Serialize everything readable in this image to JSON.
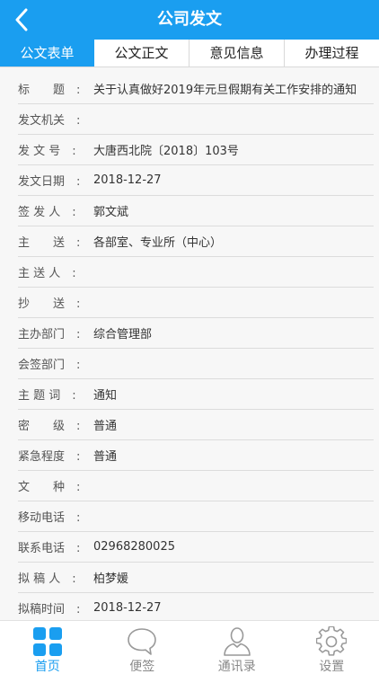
{
  "header": {
    "title": "公司发文"
  },
  "tabs": [
    {
      "label": "公文表单"
    },
    {
      "label": "公文正文"
    },
    {
      "label": "意见信息"
    },
    {
      "label": "办理过程"
    }
  ],
  "form": {
    "rows": [
      {
        "label": "标　　题　:",
        "value": "关于认真做好2019年元旦假期有关工作安排的通知"
      },
      {
        "label": "发文机关　:",
        "value": ""
      },
      {
        "label": "发 文 号　:",
        "value": "大唐西北院〔2018〕103号"
      },
      {
        "label": "发文日期　:",
        "value": "2018-12-27"
      },
      {
        "label": "签 发 人　:",
        "value": "郭文斌"
      },
      {
        "label": "主　　送　:",
        "value": "各部室、专业所（中心）"
      },
      {
        "label": "主 送 人　:",
        "value": ""
      },
      {
        "label": "抄　　送　:",
        "value": ""
      },
      {
        "label": "主办部门　:",
        "value": "综合管理部"
      },
      {
        "label": "会签部门　:",
        "value": ""
      },
      {
        "label": "主 题 词　:",
        "value": "通知"
      },
      {
        "label": "密　　级　:",
        "value": "普通"
      },
      {
        "label": "紧急程度　:",
        "value": "普通"
      },
      {
        "label": "文　　种　:",
        "value": ""
      },
      {
        "label": "移动电话　:",
        "value": ""
      },
      {
        "label": "联系电话　:",
        "value": "02968280025"
      },
      {
        "label": "拟 稿 人　:",
        "value": "柏梦媛"
      },
      {
        "label": "拟稿时间　:",
        "value": "2018-12-27"
      }
    ]
  },
  "tabbar": {
    "items": [
      {
        "label": "首页",
        "icon": "home-grid-icon"
      },
      {
        "label": "便签",
        "icon": "speech-bubble-icon"
      },
      {
        "label": "通讯录",
        "icon": "contacts-person-icon"
      },
      {
        "label": "设置",
        "icon": "gear-icon"
      }
    ]
  },
  "colors": {
    "accent": "#1a9ef0",
    "inactive": "#888888"
  }
}
